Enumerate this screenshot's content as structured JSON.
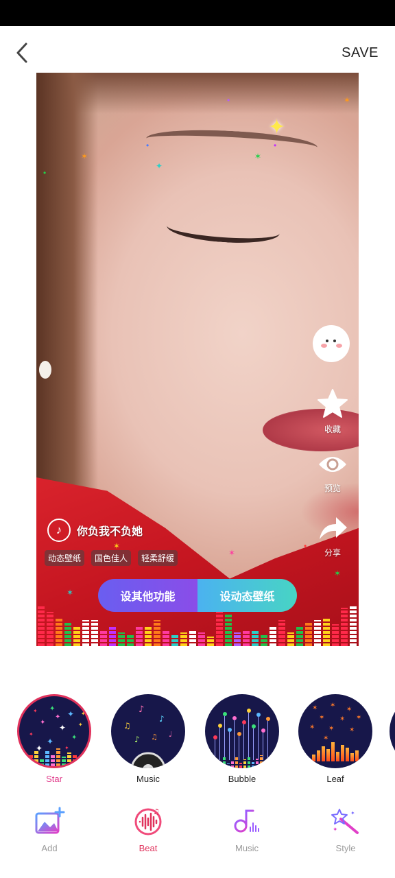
{
  "topbar": {
    "save_label": "SAVE"
  },
  "preview": {
    "song_title": "你负我不负她",
    "tags": [
      "动态壁纸",
      "国色佳人",
      "轻柔舒缓"
    ],
    "side_actions": [
      {
        "label": "收藏",
        "icon": "star-icon"
      },
      {
        "label": "预览",
        "icon": "eye-icon"
      },
      {
        "label": "分享",
        "icon": "share-arrow-icon"
      }
    ],
    "cta_left": "设其他功能",
    "cta_right": "设动态壁纸"
  },
  "effects": [
    {
      "label": "Star",
      "selected": true
    },
    {
      "label": "Music",
      "selected": false
    },
    {
      "label": "Bubble",
      "selected": false
    },
    {
      "label": "Leaf",
      "selected": false
    }
  ],
  "bottom_nav": [
    {
      "label": "Add",
      "icon": "add-image-icon",
      "active": false
    },
    {
      "label": "Beat",
      "icon": "beat-waveform-icon",
      "active": true
    },
    {
      "label": "Music",
      "icon": "music-note-icon",
      "active": false
    },
    {
      "label": "Style",
      "icon": "magic-wand-icon",
      "active": false
    }
  ],
  "colors": {
    "accent": "#e0325c",
    "effect_bg": "#17174a",
    "cta_left": "#7656ee",
    "cta_right": "#48cfc8"
  }
}
